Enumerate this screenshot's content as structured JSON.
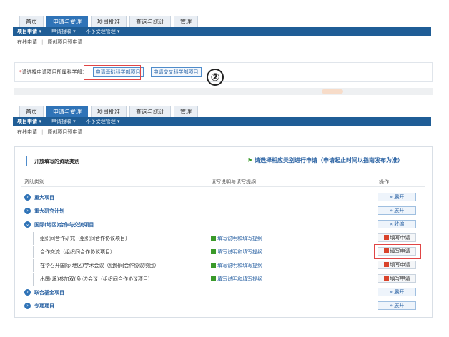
{
  "top_nav": {
    "tabs": [
      "首页",
      "申请与受理",
      "项目批准",
      "查询与统计",
      "管理"
    ],
    "active": "申请与受理"
  },
  "sub_nav": {
    "items": [
      "项目申请 ▾",
      "申请接收 ▾",
      "不予受理管理 ▾"
    ]
  },
  "breadcrumb": [
    "在线申请",
    "原创项目预申请"
  ],
  "section1": {
    "prompt": "请选择申请项目所属科学部：",
    "required_mark": "*",
    "option_selected": "申请基础科学部项目",
    "option_other": "申请交叉科学部项目"
  },
  "step_marker": "②",
  "section2": {
    "panel_tab": "开放填写的资助类别",
    "notice": "请选择相应类别进行申请（申请起止时间以指南发布为准）",
    "headers": {
      "category": "资助类别",
      "guide": "填写说明与填写提纲",
      "action": "操作"
    },
    "rows": [
      {
        "name": "重大项目",
        "level": "major",
        "action": "展开"
      },
      {
        "name": "重大研究计划",
        "level": "major",
        "action": "展开"
      },
      {
        "name": "国际(地区)合作与交流项目",
        "level": "major",
        "action": "收缩"
      },
      {
        "name": "组织间合作研究（组织间合作协议项目）",
        "level": "child",
        "guide": "填写说明和填写提纲",
        "action": "填写申请"
      },
      {
        "name": "合作交流（组织间合作协议项目）",
        "level": "child",
        "guide": "填写说明和填写提纲",
        "action": "填写申请"
      },
      {
        "name": "在华召开国际(地区)学术会议（组织间合作协议项目）",
        "level": "child",
        "guide": "填写说明和填写提纲",
        "action": "填写申请"
      },
      {
        "name": "出国(境)参加双(多)边会议（组织间合作协议项目）",
        "level": "child",
        "guide": "填写说明和填写提纲",
        "action": "填写申请"
      },
      {
        "name": "联合基金项目",
        "level": "major",
        "action": "展开"
      },
      {
        "name": "专项项目",
        "level": "major",
        "action": "展开"
      }
    ]
  },
  "colors": {
    "accent": "#2f73b7",
    "nav_dark": "#1f5d96",
    "highlight": "#e04545"
  }
}
